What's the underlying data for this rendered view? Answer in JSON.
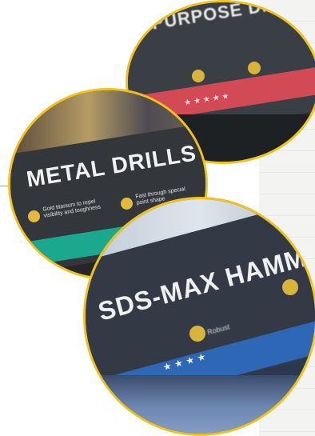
{
  "signs": {
    "purpose": {
      "title": "PURPOSE DRILL BITS",
      "stars": "★★★★★",
      "band_color": "#d24a55"
    },
    "metal": {
      "title": "METAL DRILLS",
      "features": [
        "Gold titanium to repel visibility and toughness",
        "Fast through special point shape"
      ],
      "stars": "★★★",
      "band_color": "#1aa98f"
    },
    "sds": {
      "title": "SDS-MAX HAMMER DRILLS",
      "features": [
        "Robust"
      ],
      "stars": "★★★★",
      "band_color": "#2f67b7"
    }
  },
  "colors": {
    "border": "#f3c21a",
    "sign_body": "#363b42"
  }
}
